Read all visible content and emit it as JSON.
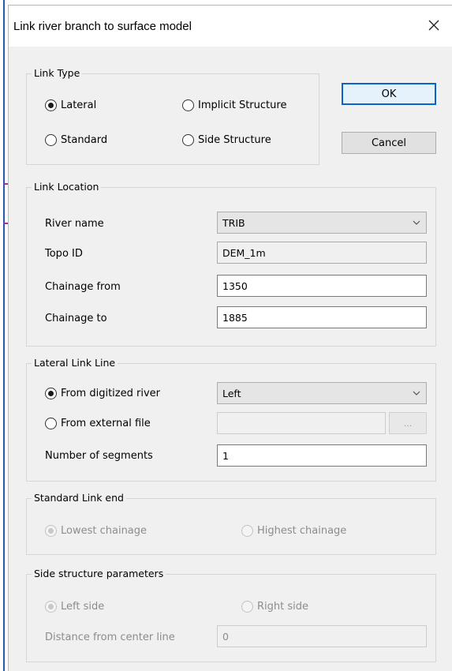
{
  "dialog": {
    "title": "Link river branch to surface model"
  },
  "buttons": {
    "ok": "OK",
    "cancel": "Cancel"
  },
  "link_type": {
    "legend": "Link Type",
    "options": {
      "lateral": "Lateral",
      "implicit_structure": "Implicit Structure",
      "standard": "Standard",
      "side_structure": "Side Structure"
    },
    "selected": "Lateral"
  },
  "link_location": {
    "legend": "Link Location",
    "river_name_label": "River name",
    "river_name_value": "TRIB",
    "topo_id_label": "Topo ID",
    "topo_id_value": "DEM_1m",
    "chainage_from_label": "Chainage from",
    "chainage_from_value": "1350",
    "chainage_to_label": "Chainage to",
    "chainage_to_value": "1885"
  },
  "lateral_link_line": {
    "legend": "Lateral Link Line",
    "from_digitized_river": "From digitized river",
    "digitized_side_value": "Left",
    "from_external_file": "From external file",
    "external_file_value": "",
    "browse_label": "...",
    "number_of_segments_label": "Number of segments",
    "number_of_segments_value": "1",
    "selected": "From digitized river"
  },
  "standard_link_end": {
    "legend": "Standard Link end",
    "lowest_chainage": "Lowest chainage",
    "highest_chainage": "Highest chainage",
    "selected": "Lowest chainage"
  },
  "side_structure_parameters": {
    "legend": "Side structure parameters",
    "left_side": "Left side",
    "right_side": "Right side",
    "distance_label": "Distance from center line",
    "distance_value": "0",
    "selected": "Left side"
  },
  "colors": {
    "accent": "#0a64c8",
    "background": "#f0f0f0"
  },
  "icons": {
    "close": "close-icon",
    "dropdown": "chevron-down-icon"
  }
}
